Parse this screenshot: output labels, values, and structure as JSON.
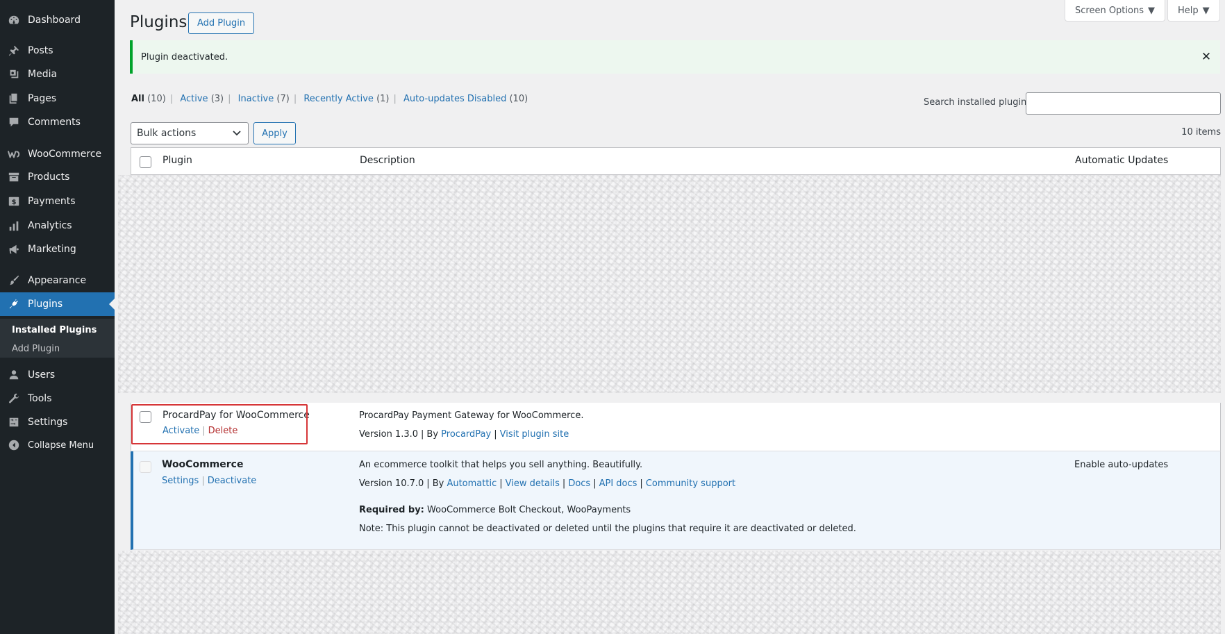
{
  "sidebar": {
    "items": [
      {
        "label": "Dashboard",
        "icon": "dashboard-icon"
      },
      {
        "label": "Posts",
        "icon": "pin-icon"
      },
      {
        "label": "Media",
        "icon": "media-icon"
      },
      {
        "label": "Pages",
        "icon": "pages-icon"
      },
      {
        "label": "Comments",
        "icon": "comment-icon"
      },
      {
        "label": "WooCommerce",
        "icon": "woo-icon"
      },
      {
        "label": "Products",
        "icon": "archive-icon"
      },
      {
        "label": "Payments",
        "icon": "dollar-icon"
      },
      {
        "label": "Analytics",
        "icon": "bar-chart-icon"
      },
      {
        "label": "Marketing",
        "icon": "megaphone-icon"
      },
      {
        "label": "Appearance",
        "icon": "brush-icon"
      },
      {
        "label": "Plugins",
        "icon": "plug-icon"
      },
      {
        "label": "Users",
        "icon": "user-icon"
      },
      {
        "label": "Tools",
        "icon": "wrench-icon"
      },
      {
        "label": "Settings",
        "icon": "sliders-icon"
      }
    ],
    "submenu": [
      "Installed Plugins",
      "Add Plugin"
    ],
    "collapse": "Collapse Menu"
  },
  "screen_meta": {
    "screen_options": "Screen Options",
    "help": "Help"
  },
  "header": {
    "title": "Plugins",
    "add_button": "Add Plugin"
  },
  "notice": {
    "text": "Plugin deactivated."
  },
  "filters": [
    {
      "label": "All",
      "count": "(10)"
    },
    {
      "label": "Active",
      "count": "(3)"
    },
    {
      "label": "Inactive",
      "count": "(7)"
    },
    {
      "label": "Recently Active",
      "count": "(1)"
    },
    {
      "label": "Auto-updates Disabled",
      "count": "(10)"
    }
  ],
  "search": {
    "label": "Search installed plugins",
    "value": ""
  },
  "bulk": {
    "selected": "Bulk actions",
    "apply": "Apply",
    "items_count": "10 items"
  },
  "table": {
    "columns": [
      "Plugin",
      "Description",
      "Automatic Updates"
    ],
    "rows": [
      {
        "name": "ProcardPay for WooCommerce",
        "actions": [
          "Activate",
          "Delete"
        ],
        "description": "ProcardPay Payment Gateway for WooCommerce.",
        "version": "Version 1.3.0",
        "by": "By",
        "author": "ProcardPay",
        "links": [
          "Visit plugin site"
        ]
      },
      {
        "name": "WooCommerce",
        "actions": [
          "Settings",
          "Deactivate"
        ],
        "description": "An ecommerce toolkit that helps you sell anything. Beautifully.",
        "version": "Version 10.7.0",
        "by": "By",
        "author": "Automattic",
        "links": [
          "View details",
          "Docs",
          "API docs",
          "Community support"
        ],
        "required_label": "Required by:",
        "required_value": "WooCommerce Bolt Checkout, WooPayments",
        "note": "Note: This plugin cannot be deactivated or deleted until the plugins that require it are deactivated or deleted.",
        "auto_update": "Enable auto-updates"
      }
    ]
  },
  "colors": {
    "sidebar_bg": "#1d2327",
    "accent": "#2271b1",
    "notice_success": "#00a32a",
    "danger": "#b32d2e"
  }
}
